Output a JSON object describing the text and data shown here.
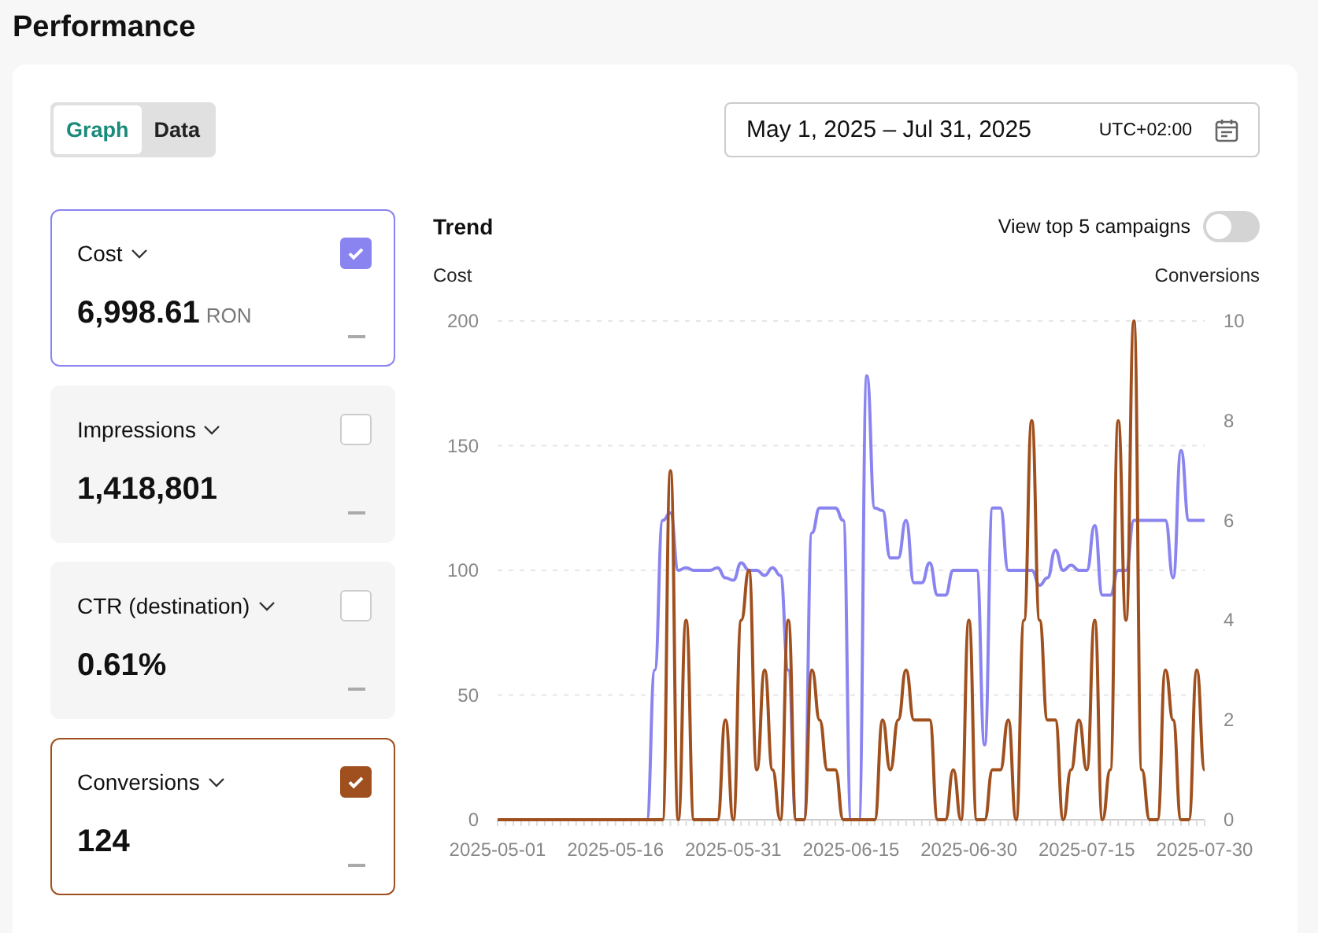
{
  "title": "Performance",
  "view_tabs": [
    {
      "label": "Graph",
      "selected": true
    },
    {
      "label": "Data",
      "selected": false
    }
  ],
  "date_range": {
    "value": "May 1, 2025 – Jul 31, 2025",
    "timezone": "UTC+02:00"
  },
  "metrics": [
    {
      "name": "Cost",
      "value": "6,998.61",
      "unit": "RON",
      "checked": true,
      "color": "#8a84f0"
    },
    {
      "name": "Impressions",
      "value": "1,418,801",
      "checked": false
    },
    {
      "name": "CTR (destination)",
      "value": "0.61%",
      "checked": false
    },
    {
      "name": "Conversions",
      "value": "124",
      "checked": true,
      "color": "#a0501e"
    }
  ],
  "trend": {
    "title": "Trend",
    "top_campaigns_toggle": {
      "label": "View top 5 campaigns",
      "on": false
    },
    "chart_data": {
      "type": "line",
      "grid": true,
      "ylabel": "Cost",
      "y2label": "Conversions",
      "categories": [
        "2025-05-01",
        null,
        null,
        null,
        null,
        null,
        null,
        null,
        null,
        null,
        null,
        null,
        null,
        null,
        null,
        "2025-05-16",
        null,
        null,
        null,
        null,
        null,
        null,
        null,
        null,
        null,
        null,
        null,
        null,
        null,
        null,
        "2025-05-31",
        null,
        null,
        null,
        null,
        null,
        null,
        null,
        null,
        null,
        null,
        null,
        null,
        null,
        null,
        "2025-06-15",
        null,
        null,
        null,
        null,
        null,
        null,
        null,
        null,
        null,
        null,
        null,
        null,
        null,
        null,
        "2025-06-30",
        null,
        null,
        null,
        null,
        null,
        null,
        null,
        null,
        null,
        null,
        null,
        null,
        null,
        null,
        "2025-07-15",
        null,
        null,
        null,
        null,
        null,
        null,
        null,
        null,
        null,
        null,
        null,
        null,
        null,
        null,
        "2025-07-30"
      ],
      "ylim": [
        0,
        200
      ],
      "yticks": [
        0,
        50,
        100,
        150,
        200
      ],
      "y2lim": [
        0,
        10
      ],
      "y2ticks": [
        0,
        2,
        4,
        6,
        8,
        10
      ],
      "series": [
        {
          "color": "#8a84f0",
          "values": [
            null,
            null,
            null,
            null,
            null,
            null,
            null,
            null,
            null,
            null,
            null,
            null,
            null,
            null,
            null,
            null,
            null,
            null,
            null,
            0,
            60,
            120,
            123,
            100,
            101,
            100,
            100,
            100,
            101,
            97,
            96,
            103,
            100,
            100,
            98,
            101,
            98,
            60,
            0,
            0,
            115,
            125,
            125,
            125,
            120,
            0,
            0,
            178,
            125,
            124,
            105,
            105,
            120,
            95,
            95,
            103,
            90,
            90,
            100,
            100,
            100,
            100,
            30,
            125,
            125,
            100,
            100,
            100,
            100,
            94,
            97,
            108,
            100,
            102,
            100,
            100,
            118,
            90,
            90,
            100,
            100,
            120,
            120,
            120,
            120,
            120,
            97,
            148,
            120,
            120,
            120
          ]
        },
        {
          "color": "#a0501e",
          "axis": "y2",
          "values": [
            0,
            0,
            0,
            0,
            0,
            0,
            0,
            0,
            0,
            0,
            0,
            0,
            0,
            0,
            0,
            0,
            0,
            0,
            0,
            0,
            0,
            0,
            7,
            0,
            4,
            0,
            0,
            0,
            0,
            2,
            0,
            4,
            5,
            1,
            3,
            1,
            0,
            4,
            0,
            0,
            3,
            2,
            1,
            1,
            0,
            0,
            0,
            0,
            0,
            2,
            1,
            2,
            3,
            2,
            2,
            2,
            0,
            0,
            1,
            0,
            4,
            0,
            0,
            1,
            1,
            2,
            0,
            4,
            8,
            4,
            2,
            2,
            0,
            1,
            2,
            1,
            4,
            0,
            1,
            8,
            4,
            10,
            1,
            0,
            0,
            3,
            2,
            0,
            0,
            3,
            1
          ]
        }
      ]
    }
  }
}
